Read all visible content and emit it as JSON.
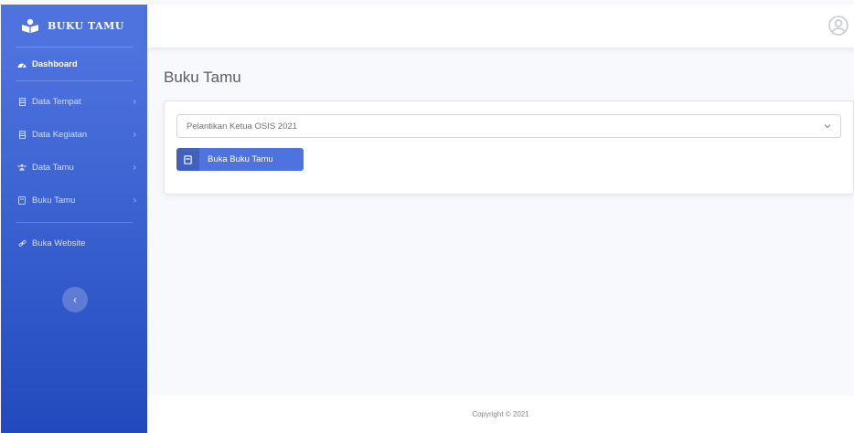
{
  "brand": {
    "name": "BUKU TAMU",
    "icon": "book-reader-icon"
  },
  "sidebar": {
    "dashboard": {
      "label": "Dashboard",
      "icon": "dashboard-icon"
    },
    "items": [
      {
        "label": "Data Tempat",
        "icon": "table-icon"
      },
      {
        "label": "Data Kegiatan",
        "icon": "table-icon"
      },
      {
        "label": "Data Tamu",
        "icon": "users-icon"
      },
      {
        "label": "Buku Tamu",
        "icon": "book-icon"
      }
    ],
    "website": {
      "label": "Buka Website",
      "icon": "link-icon"
    },
    "toggle_icon": "chevron-left-icon"
  },
  "topbar": {
    "user_icon": "user-circle-icon"
  },
  "main": {
    "title": "Buku Tamu",
    "select": {
      "value": "Pelantikan Ketua OSIS 2021"
    },
    "button": {
      "label": "Buka Buku Tamu",
      "icon": "book-icon"
    }
  },
  "footer": {
    "copyright": "Copyright © 2021"
  },
  "colors": {
    "primary": "#4e73df",
    "sidebar_dark": "#224abe",
    "background": "#f8f9fc"
  }
}
